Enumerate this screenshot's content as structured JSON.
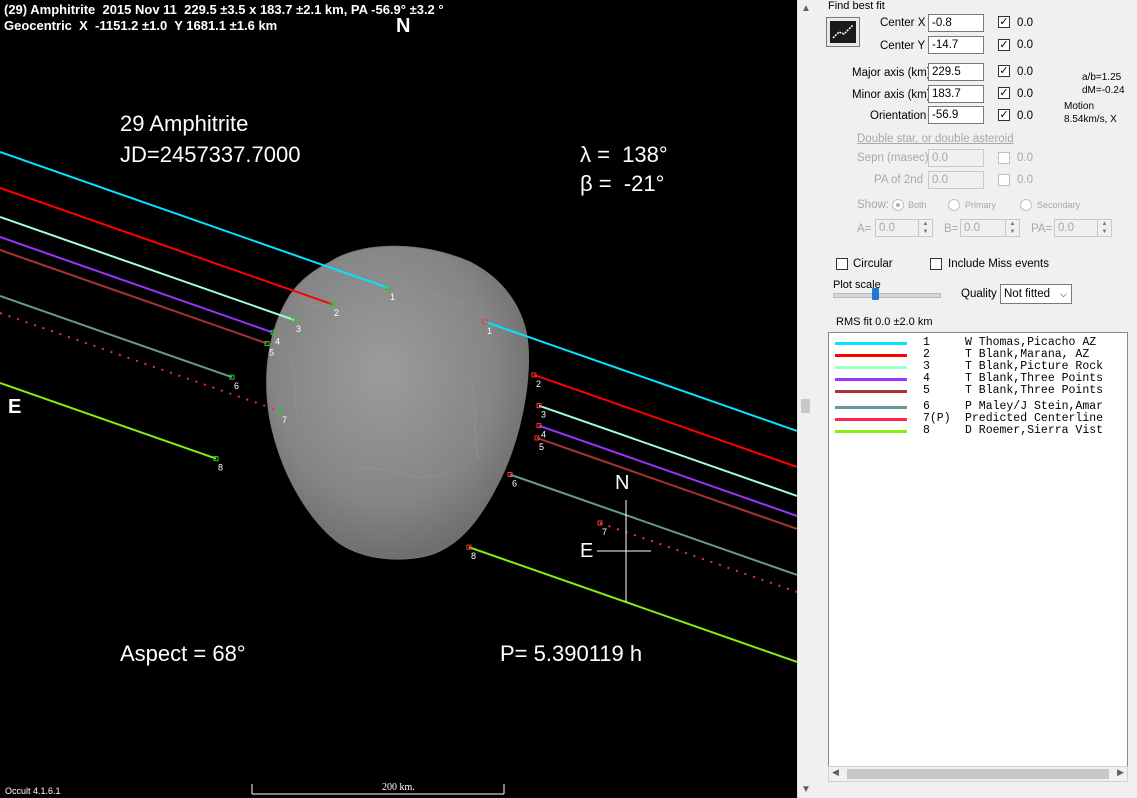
{
  "plot": {
    "header_line1": "(29) Amphitrite  2015 Nov 11  229.5 ±3.5 x 183.7 ±2.1 km, PA -56.9° ±3.2 °",
    "header_line2": "Geocentric  X  -1151.2 ±1.0  Y 1681.1 ±1.6 km",
    "north_top": "N",
    "east_left": "E",
    "asteroid_name": "29 Amphitrite",
    "jd": "JD=2457337.7000",
    "lambda": "λ =  138°",
    "beta": "β =  -21°",
    "aspect": "Aspect = 68°",
    "period": "P= 5.390119 h",
    "north_marker": "N",
    "east_marker": "E",
    "scale_label": "200 km.",
    "version": "Occult 4.1.6.1",
    "chord_labels": [
      "1",
      "2",
      "3",
      "4",
      "5",
      "6",
      "7",
      "8"
    ]
  },
  "panel": {
    "find_best_fit": "Find best fit",
    "center_x_label": "Center X",
    "center_x_value": "-0.8",
    "center_x_unc": "0.0",
    "center_y_label": "Center Y",
    "center_y_value": "-14.7",
    "center_y_unc": "0.0",
    "major_label": "Major axis (km)",
    "major_value": "229.5",
    "major_unc": "0.0",
    "minor_label": "Minor axis (km)",
    "minor_value": "183.7",
    "minor_unc": "0.0",
    "orient_label": "Orientation",
    "orient_value": "-56.9",
    "orient_unc": "0.0",
    "ab_ratio": "a/b=1.25",
    "dm": "dM=-0.24",
    "motion_label": "Motion",
    "motion_value": "8.54km/s, X",
    "double_star_link": "Double star, or double asteroid",
    "sepn_label": "Sepn (masec)",
    "sepn_value": "0.0",
    "sepn_unc": "0.0",
    "pa2_label": "PA of 2nd",
    "pa2_value": "0.0",
    "pa2_unc": "0.0",
    "show_label": "Show:",
    "show_both": "Both",
    "show_primary": "Primary",
    "show_secondary": "Secondary",
    "a_label": "A=",
    "a_value": "0.0",
    "b_label": "B=",
    "b_value": "0.0",
    "pa_label": "PA=",
    "pa_value": "0.0",
    "circular_label": "Circular",
    "include_miss_label": "Include Miss events",
    "plot_scale_label": "Plot scale",
    "quality_label": "Quality",
    "quality_value": "Not fitted",
    "rms_fit": "RMS fit 0.0 ±2.0 km"
  },
  "legend": [
    {
      "num": "1",
      "observer": "W Thomas,Picacho AZ",
      "color": "#00e5ff"
    },
    {
      "num": "2",
      "observer": "T Blank,Marana, AZ",
      "color": "#ff0000"
    },
    {
      "num": "3",
      "observer": "T Blank,Picture Rock",
      "color": "#a0ffd0"
    },
    {
      "num": "4",
      "observer": "T Blank,Three Points",
      "color": "#9933ff"
    },
    {
      "num": "5",
      "observer": "T Blank,Three Points",
      "color": "#aa3333"
    },
    {
      "num": "6",
      "observer": "P Maley/J Stein,Amar",
      "color": "#669999"
    },
    {
      "num": "7(P)",
      "observer": "Predicted Centerline",
      "color": "#ff2255"
    },
    {
      "num": "8",
      "observer": "D Roemer,Sierra Vist",
      "color": "#88ee11"
    }
  ],
  "colors": {
    "plot_bg": "#000000",
    "panel_bg": "#f0f0f0",
    "asteroid": "#8a8a8a"
  }
}
